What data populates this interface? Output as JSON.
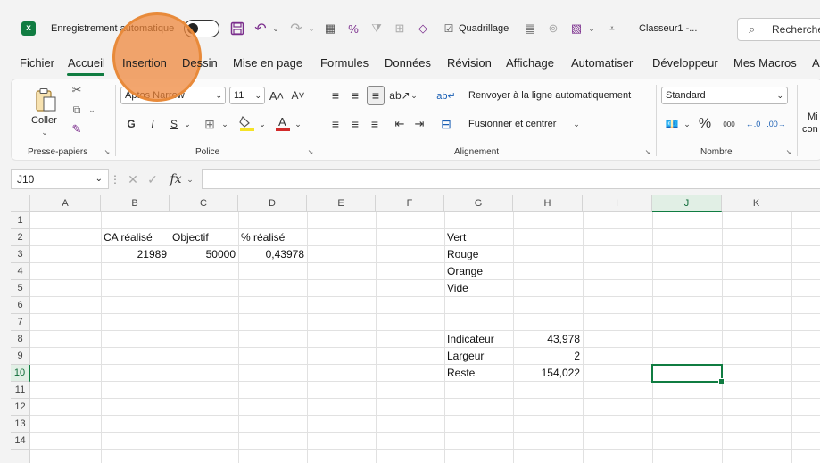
{
  "titlebar": {
    "autosave_label": "Enregistrement automatique",
    "gridlines_label": "Quadrillage",
    "filename": "Classeur1 -...",
    "search_placeholder": "Recherche"
  },
  "menu": {
    "tabs": [
      "Fichier",
      "Accueil",
      "Insertion",
      "Dessin",
      "Mise en page",
      "Formules",
      "Données",
      "Révision",
      "Affichage",
      "Automatiser",
      "Développeur",
      "Mes Macros",
      "A"
    ],
    "active": "Accueil"
  },
  "ribbon": {
    "clipboard": {
      "paste_label": "Coller",
      "group_label": "Presse-papiers"
    },
    "font": {
      "font_name": "Aptos Narrow",
      "font_size": "11",
      "bold": "G",
      "italic": "I",
      "underline": "S",
      "group_label": "Police"
    },
    "alignment": {
      "wrap_label": "Renvoyer à la ligne automatiquement",
      "merge_label": "Fusionner et centrer",
      "group_label": "Alignement"
    },
    "number": {
      "format": "Standard",
      "percent": "%",
      "thousands": "000",
      "group_label": "Nombre"
    },
    "cond": {
      "label_line1": "Mi",
      "label_line2": "con"
    }
  },
  "formula_bar": {
    "cell_ref": "J10",
    "fx": "fx",
    "content": ""
  },
  "grid": {
    "columns": [
      "A",
      "B",
      "C",
      "D",
      "E",
      "F",
      "G",
      "H",
      "I",
      "J",
      "K"
    ],
    "rows": [
      "1",
      "2",
      "3",
      "4",
      "5",
      "6",
      "7",
      "8",
      "9",
      "10",
      "11",
      "12",
      "13",
      "14"
    ],
    "selected_col": "J",
    "selected_row": "10",
    "cells": {
      "B2": "CA réalisé",
      "C2": "Objectif",
      "D2": "% réalisé",
      "B3": "21989",
      "C3": "50000",
      "D3": "0,43978",
      "G2": "Vert",
      "G3": "Rouge",
      "G4": "Orange",
      "G5": "Vide",
      "G8": "Indicateur",
      "H8": "43,978",
      "G9": "Largeur",
      "H9": "2",
      "G10": "Reste",
      "H10": "154,022"
    }
  },
  "colors": {
    "excel_green": "#107c41",
    "highlight_orange": "#ef8436"
  }
}
